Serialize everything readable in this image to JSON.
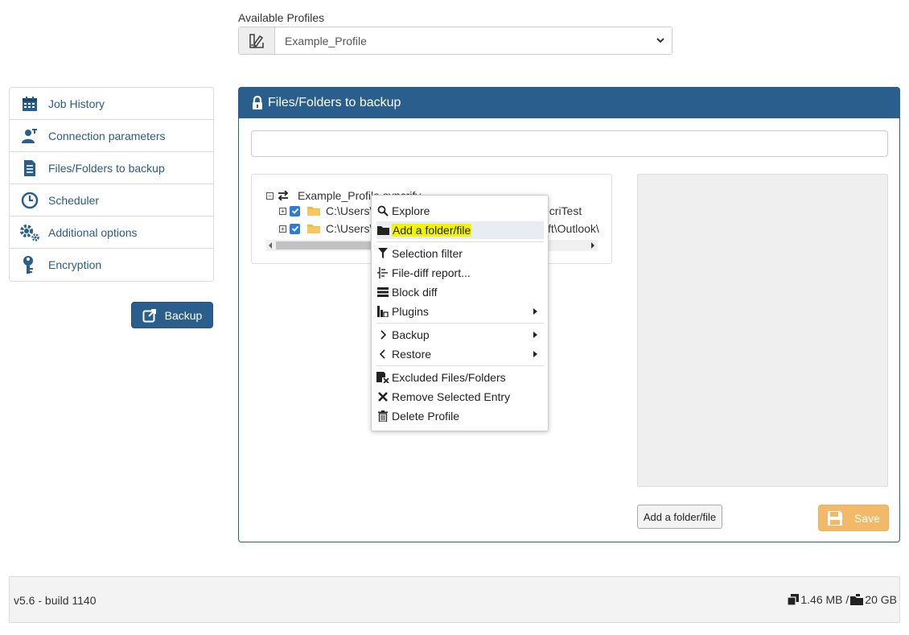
{
  "profile": {
    "label": "Available Profiles",
    "selected": "Example_Profile",
    "icon": "profile-swatch-icon"
  },
  "sidebar": {
    "items": [
      {
        "label": "Job History",
        "icon": "calendar-icon"
      },
      {
        "label": "Connection parameters",
        "icon": "user-settings-icon"
      },
      {
        "label": "Files/Folders to backup",
        "icon": "document-icon"
      },
      {
        "label": "Scheduler",
        "icon": "clock-icon"
      },
      {
        "label": "Additional options",
        "icon": "gears-icon"
      },
      {
        "label": "Encryption",
        "icon": "key-icon"
      }
    ],
    "backup_label": "Backup"
  },
  "panel": {
    "title": "Files/Folders to backup",
    "path_value": "",
    "tree": {
      "root": "Example_Profile.syncrify",
      "children": [
        {
          "path_start": "C:\\Users\\",
          "path_end": "ncriTest",
          "checked": true
        },
        {
          "path_start": "C:\\Users\\",
          "path_end": "ft\\Outlook\\",
          "checked": true
        }
      ]
    },
    "add_button": "Add a folder/file",
    "save_button": "Save"
  },
  "context_menu": {
    "items": [
      {
        "label": "Explore",
        "icon": "search-icon"
      },
      {
        "label": "Add a folder/file",
        "icon": "folder-icon",
        "highlighted": true
      },
      {
        "label": "Selection filter",
        "icon": "filter-icon"
      },
      {
        "label": "File-diff report...",
        "icon": "diff-report-icon"
      },
      {
        "label": "Block diff",
        "icon": "block-diff-icon"
      },
      {
        "label": "Plugins",
        "icon": "plugins-icon",
        "submenu": true
      },
      {
        "label": "Backup",
        "icon": "chevron-right-icon",
        "submenu": true
      },
      {
        "label": "Restore",
        "icon": "chevron-left-icon",
        "submenu": true
      },
      {
        "label": "Excluded Files/Folders",
        "icon": "excluded-icon"
      },
      {
        "label": "Remove Selected Entry",
        "icon": "times-icon"
      },
      {
        "label": "Delete Profile",
        "icon": "trash-icon"
      }
    ],
    "highlight_color": "#f2f400"
  },
  "footer": {
    "version": "v5.6 - build 1140",
    "used": "1.46 MB /",
    "quota": "20 GB"
  },
  "colors": {
    "brand": "#2a5e8c",
    "save": "#f0ad4e",
    "link": "#2a5a8a"
  }
}
